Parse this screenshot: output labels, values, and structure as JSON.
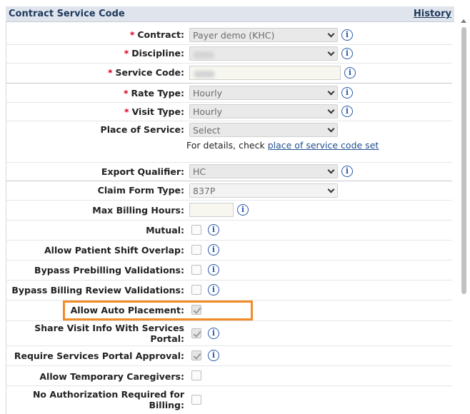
{
  "header": {
    "title": "Contract Service Code",
    "history_link": "History"
  },
  "required_marker": "*",
  "fields": {
    "contract": {
      "label": "Contract:",
      "value": "Payer demo (KHC)"
    },
    "discipline": {
      "label": "Discipline:",
      "value": ""
    },
    "service_code": {
      "label": "Service Code:",
      "value": ""
    },
    "rate_type": {
      "label": "Rate Type:",
      "value": "Hourly"
    },
    "visit_type": {
      "label": "Visit Type:",
      "value": "Hourly"
    },
    "place_of_service": {
      "label": "Place of Service:",
      "value": "Select",
      "details_text": "For details, check",
      "details_link": "place of service code set"
    },
    "export_qualifier": {
      "label": "Export Qualifier:",
      "value": "HC"
    },
    "claim_form_type": {
      "label": "Claim Form Type:",
      "value": "837P"
    },
    "max_billing_hours": {
      "label": "Max Billing Hours:",
      "value": ""
    }
  },
  "checkboxes": [
    {
      "label": "Mutual:",
      "checked": false
    },
    {
      "label": "Allow Patient Shift Overlap:",
      "checked": false
    },
    {
      "label": "Bypass Prebilling Validations:",
      "checked": false
    },
    {
      "label": "Bypass Billing Review Validations:",
      "checked": false
    },
    {
      "label": "Allow Auto Placement:",
      "checked": true
    },
    {
      "label": "Share Visit Info With Services Portal:",
      "checked": true
    },
    {
      "label": "Require Services Portal Approval:",
      "checked": true
    },
    {
      "label": "Allow Temporary Caregivers:",
      "checked": false
    },
    {
      "label": "No Authorization Required for Billing:",
      "checked": false
    }
  ],
  "info_glyph": "i",
  "icons": {
    "info": "info-icon",
    "dropdown": "chevron-down-icon"
  },
  "colors": {
    "header_bg": "#dfe4ed",
    "required": "#d0021b",
    "info": "#2b5aa8",
    "highlight": "#f28c28"
  }
}
